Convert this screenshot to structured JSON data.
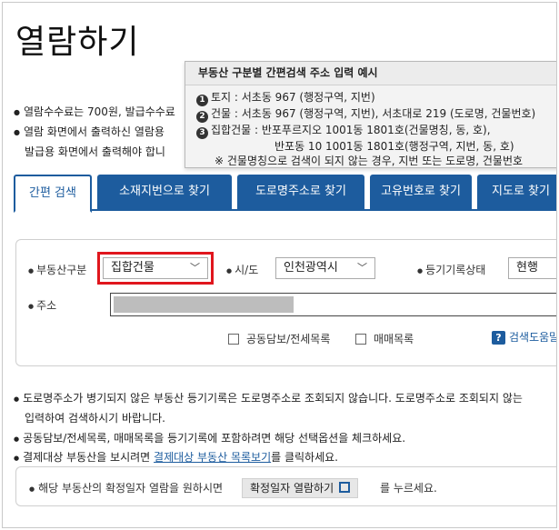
{
  "page": {
    "title": "열람하기"
  },
  "notices": [
    "열람수수료는 700원, 발급수수료",
    "열람 화면에서 출력하신 열람용",
    "발급용 화면에서 출력해야 합니"
  ],
  "tooltip": {
    "title": "부동산 구분별 간편검색 주소 입력 예시",
    "items": [
      {
        "num": "1",
        "text": "토지 : 서초동 967 (행정구역, 지번)"
      },
      {
        "num": "2",
        "text": "건물 : 서초동 967 (행정구역, 지번), 서초대로 219 (도로명, 건물번호)"
      },
      {
        "num": "3",
        "text": "집합건물 : 반포푸르지오 1001동 1801호(건물명칭, 동, 호),"
      },
      {
        "num": "",
        "text": "반포동 10 1001동 1801호(행정구역, 지번, 동, 호)"
      },
      {
        "num": "",
        "text": "※ 건물명칭으로 검색이 되지 않는 경우, 지번 또는 도로명, 건물번호"
      }
    ]
  },
  "tabs": [
    "간편 검색",
    "소재지번으로 찾기",
    "도로명주소로 찾기",
    "고유번호로 찾기",
    "지도로 찾기"
  ],
  "search": {
    "property_type_label": "부동산구분",
    "property_type_value": "집합건물",
    "region_label": "시/도",
    "region_value": "인천광역시",
    "status_label": "등기기록상태",
    "status_value": "현행",
    "address_label": "주소",
    "check_joint": "공동담보/전세목록",
    "check_sale": "매매목록",
    "help_label": "검색도움말"
  },
  "info": {
    "line1": "도로명주소가 병기되지 않은 부동산 등기기록은 도로명주소로 조회되지 않습니다. 도로명주소로 조회되지 않는",
    "line1b": "입력하여 검색하시기 바랍니다.",
    "line2": "공동담보/전세목록, 매매목록을 등기기록에 포함하려면 해당 선택옵션을 체크하세요.",
    "line3_prefix": "결제대상 부동산을 보시려면 ",
    "line3_link": "결제대상 부동산 목록보기",
    "line3_suffix": "를 클릭하세요."
  },
  "bottom": {
    "text": "해당 부동산의 확정일자 열람을 원하시면",
    "button": "확정일자 열람하기",
    "tail": "를 누르세요."
  },
  "colors": {
    "accent": "#1d5c9e",
    "highlight": "#e0161d"
  }
}
